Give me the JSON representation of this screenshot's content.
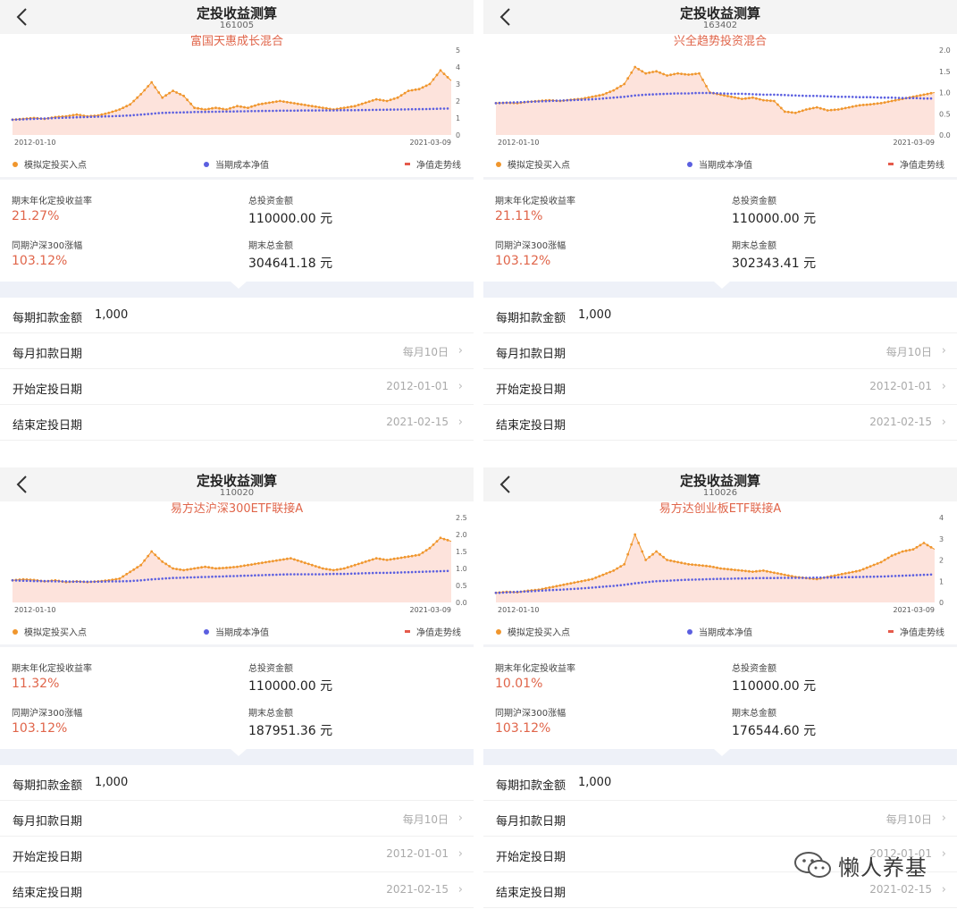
{
  "legend": {
    "buy": "模拟定投买入点",
    "cost": "当期成本净值",
    "trend": "净值走势线"
  },
  "colors": {
    "orange": "#f0962d",
    "blue": "#5b5fe0",
    "red": "#e0654a",
    "fill": "#fde3dc"
  },
  "icons": {
    "back": "chevron-left-icon",
    "row_arrow": "chevron-right-icon",
    "watermark": "wechat-icon"
  },
  "panels": [
    {
      "title": "定投收益测算",
      "code": "161005",
      "fund_name": "富国天惠成长混合",
      "stats": {
        "annual_label": "期末年化定投收益率",
        "annual_value": "21.27%",
        "invest_label": "总投资金额",
        "invest_value": "110000.00 元",
        "hs300_label": "同期沪深300涨幅",
        "hs300_value": "103.12%",
        "final_label": "期末总金额",
        "final_value": "304641.18 元"
      },
      "settings": [
        {
          "label": "每期扣款金额",
          "value": "1,000"
        },
        {
          "label": "每月扣款日期",
          "value": "每月10日"
        },
        {
          "label": "开始定投日期",
          "value": "2012-01-01"
        },
        {
          "label": "结束定投日期",
          "value": "2021-02-15"
        }
      ]
    },
    {
      "title": "定投收益测算",
      "code": "163402",
      "fund_name": "兴全趋势投资混合",
      "stats": {
        "annual_label": "期末年化定投收益率",
        "annual_value": "21.11%",
        "invest_label": "总投资金额",
        "invest_value": "110000.00 元",
        "hs300_label": "同期沪深300涨幅",
        "hs300_value": "103.12%",
        "final_label": "期末总金额",
        "final_value": "302343.41 元"
      },
      "settings": [
        {
          "label": "每期扣款金额",
          "value": "1,000"
        },
        {
          "label": "每月扣款日期",
          "value": "每月10日"
        },
        {
          "label": "开始定投日期",
          "value": "2012-01-01"
        },
        {
          "label": "结束定投日期",
          "value": "2021-02-15"
        }
      ]
    },
    {
      "title": "定投收益测算",
      "code": "110020",
      "fund_name": "易方达沪深300ETF联接A",
      "stats": {
        "annual_label": "期末年化定投收益率",
        "annual_value": "11.32%",
        "invest_label": "总投资金额",
        "invest_value": "110000.00 元",
        "hs300_label": "同期沪深300涨幅",
        "hs300_value": "103.12%",
        "final_label": "期末总金额",
        "final_value": "187951.36 元"
      },
      "settings": [
        {
          "label": "每期扣款金额",
          "value": "1,000"
        },
        {
          "label": "每月扣款日期",
          "value": "每月10日"
        },
        {
          "label": "开始定投日期",
          "value": "2012-01-01"
        },
        {
          "label": "结束定投日期",
          "value": "2021-02-15"
        }
      ]
    },
    {
      "title": "定投收益测算",
      "code": "110026",
      "fund_name": "易方达创业板ETF联接A",
      "stats": {
        "annual_label": "期末年化定投收益率",
        "annual_value": "10.01%",
        "invest_label": "总投资金额",
        "invest_value": "110000.00 元",
        "hs300_label": "同期沪深300涨幅",
        "hs300_value": "103.12%",
        "final_label": "期末总金额",
        "final_value": "176544.60 元"
      },
      "settings": [
        {
          "label": "每期扣款金额",
          "value": "1,000"
        },
        {
          "label": "每月扣款日期",
          "value": "每月10日"
        },
        {
          "label": "开始定投日期",
          "value": "2012-01-01"
        },
        {
          "label": "结束定投日期",
          "value": "2021-02-15"
        }
      ]
    }
  ],
  "watermark": {
    "text": "懒人养基"
  },
  "chart_data": [
    {
      "type": "line",
      "title": "富国天惠成长混合",
      "x_start": "2012-01-10",
      "x_end": "2021-03-09",
      "ylim": [
        0,
        5
      ],
      "yticks": [
        "0",
        "1",
        "2",
        "3",
        "4",
        "5"
      ],
      "series": [
        {
          "name": "净值走势线",
          "values": [
            0.9,
            0.95,
            1.0,
            0.95,
            1.05,
            1.1,
            1.2,
            1.1,
            1.15,
            1.3,
            1.5,
            1.8,
            2.4,
            3.1,
            2.2,
            2.6,
            2.3,
            1.6,
            1.5,
            1.6,
            1.5,
            1.7,
            1.6,
            1.8,
            1.9,
            2.0,
            1.9,
            1.8,
            1.7,
            1.6,
            1.5,
            1.6,
            1.7,
            1.9,
            2.1,
            2.0,
            2.2,
            2.6,
            2.7,
            3.0,
            3.8,
            3.2
          ]
        },
        {
          "name": "当期成本净值",
          "values": [
            0.9,
            0.92,
            0.95,
            0.97,
            1.0,
            1.02,
            1.04,
            1.06,
            1.08,
            1.1,
            1.12,
            1.15,
            1.2,
            1.25,
            1.3,
            1.32,
            1.33,
            1.35,
            1.36,
            1.37,
            1.38,
            1.39,
            1.4,
            1.41,
            1.42,
            1.43,
            1.43,
            1.44,
            1.44,
            1.45,
            1.45,
            1.46,
            1.46,
            1.47,
            1.48,
            1.49,
            1.5,
            1.51,
            1.52,
            1.53,
            1.55,
            1.56
          ]
        }
      ]
    },
    {
      "type": "line",
      "title": "兴全趋势投资混合",
      "x_start": "2012-01-10",
      "x_end": "2021-03-09",
      "ylim": [
        0,
        2
      ],
      "yticks": [
        "0.0",
        "0.5",
        "1.0",
        "1.5",
        "2.0"
      ],
      "series": [
        {
          "name": "净值走势线",
          "values": [
            0.75,
            0.76,
            0.75,
            0.78,
            0.8,
            0.82,
            0.8,
            0.83,
            0.85,
            0.9,
            0.95,
            1.05,
            1.2,
            1.6,
            1.45,
            1.5,
            1.4,
            1.45,
            1.42,
            1.45,
            1.0,
            0.95,
            0.9,
            0.85,
            0.88,
            0.82,
            0.8,
            0.55,
            0.52,
            0.6,
            0.65,
            0.58,
            0.6,
            0.65,
            0.7,
            0.72,
            0.75,
            0.8,
            0.85,
            0.9,
            0.95,
            1.0
          ]
        },
        {
          "name": "当期成本净值",
          "values": [
            0.75,
            0.76,
            0.77,
            0.78,
            0.79,
            0.8,
            0.81,
            0.82,
            0.83,
            0.84,
            0.86,
            0.88,
            0.9,
            0.93,
            0.95,
            0.96,
            0.97,
            0.98,
            0.98,
            0.99,
            0.99,
            0.98,
            0.97,
            0.97,
            0.96,
            0.95,
            0.95,
            0.94,
            0.93,
            0.92,
            0.92,
            0.91,
            0.9,
            0.9,
            0.89,
            0.89,
            0.88,
            0.88,
            0.87,
            0.87,
            0.86,
            0.86
          ]
        }
      ]
    },
    {
      "type": "line",
      "title": "易方达沪深300ETF联接A",
      "x_start": "2012-01-10",
      "x_end": "2021-03-09",
      "ylim": [
        0,
        2.5
      ],
      "yticks": [
        "0.0",
        "0.5",
        "1.0",
        "1.5",
        "2.0",
        "2.5"
      ],
      "series": [
        {
          "name": "净值走势线",
          "values": [
            0.65,
            0.68,
            0.66,
            0.62,
            0.65,
            0.6,
            0.62,
            0.6,
            0.62,
            0.65,
            0.7,
            0.9,
            1.1,
            1.5,
            1.2,
            1.0,
            0.95,
            1.0,
            1.05,
            1.0,
            1.02,
            1.05,
            1.1,
            1.15,
            1.2,
            1.25,
            1.3,
            1.2,
            1.1,
            1.0,
            0.95,
            1.0,
            1.1,
            1.2,
            1.3,
            1.25,
            1.3,
            1.35,
            1.4,
            1.6,
            1.9,
            1.8
          ]
        },
        {
          "name": "当期成本净值",
          "values": [
            0.65,
            0.64,
            0.63,
            0.63,
            0.62,
            0.62,
            0.61,
            0.61,
            0.61,
            0.62,
            0.62,
            0.63,
            0.65,
            0.68,
            0.7,
            0.72,
            0.73,
            0.74,
            0.75,
            0.76,
            0.77,
            0.78,
            0.79,
            0.8,
            0.81,
            0.82,
            0.83,
            0.83,
            0.83,
            0.83,
            0.84,
            0.84,
            0.85,
            0.86,
            0.87,
            0.87,
            0.88,
            0.89,
            0.9,
            0.91,
            0.92,
            0.93
          ]
        }
      ]
    },
    {
      "type": "line",
      "title": "易方达创业板ETF联接A",
      "x_start": "2012-01-10",
      "x_end": "2021-03-09",
      "ylim": [
        0,
        4
      ],
      "yticks": [
        "0",
        "1",
        "2",
        "3",
        "4"
      ],
      "series": [
        {
          "name": "净值走势线",
          "values": [
            0.45,
            0.5,
            0.48,
            0.55,
            0.6,
            0.7,
            0.8,
            0.9,
            1.0,
            1.1,
            1.3,
            1.5,
            1.8,
            3.2,
            2.0,
            2.4,
            2.0,
            1.9,
            1.8,
            1.75,
            1.7,
            1.6,
            1.55,
            1.5,
            1.45,
            1.5,
            1.4,
            1.3,
            1.2,
            1.15,
            1.1,
            1.2,
            1.3,
            1.4,
            1.5,
            1.7,
            1.9,
            2.2,
            2.4,
            2.5,
            2.8,
            2.5
          ]
        },
        {
          "name": "当期成本净值",
          "values": [
            0.45,
            0.47,
            0.5,
            0.52,
            0.55,
            0.58,
            0.6,
            0.63,
            0.66,
            0.7,
            0.74,
            0.78,
            0.83,
            0.9,
            0.95,
            1.0,
            1.02,
            1.05,
            1.07,
            1.08,
            1.1,
            1.11,
            1.12,
            1.13,
            1.14,
            1.15,
            1.15,
            1.16,
            1.16,
            1.16,
            1.17,
            1.17,
            1.18,
            1.19,
            1.2,
            1.21,
            1.22,
            1.24,
            1.26,
            1.28,
            1.3,
            1.32
          ]
        }
      ]
    }
  ]
}
